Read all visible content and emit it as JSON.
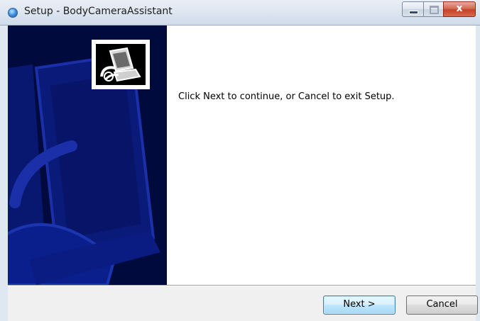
{
  "window": {
    "title": "Setup - BodyCameraAssistant",
    "icon": "setup-app-icon",
    "controls": {
      "minimize_icon": "minimize-icon",
      "maximize_icon": "maximize-icon",
      "close_glyph": "x"
    }
  },
  "banner": {
    "background_color": "#000a3c",
    "accent_color": "#0a1e8c",
    "logo_icon": "installer-computer-icon"
  },
  "content": {
    "message": "Click Next to continue, or Cancel to exit Setup."
  },
  "footer": {
    "next_label": "Next >",
    "cancel_label": "Cancel"
  }
}
